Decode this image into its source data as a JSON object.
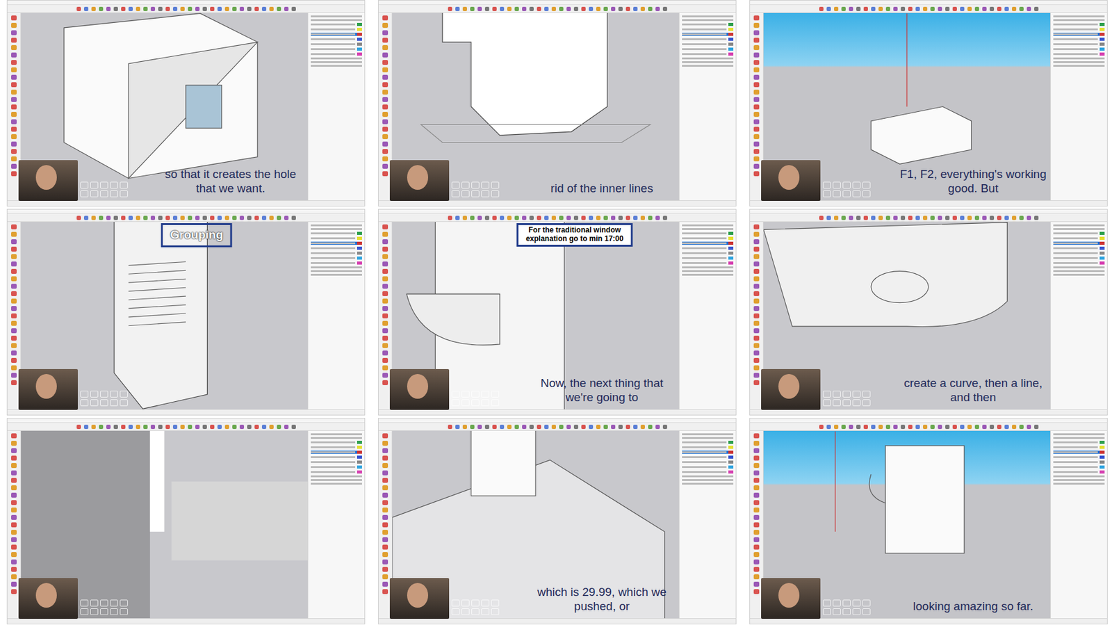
{
  "frames": [
    {
      "caption": [
        "so that it creates the hole",
        "that we want."
      ],
      "kind": "plain"
    },
    {
      "caption": [
        "rid of the inner lines"
      ],
      "kind": "plain"
    },
    {
      "caption": [
        "F1, F2, everything's working",
        "good. But"
      ],
      "kind": "sky"
    },
    {
      "caption": [],
      "kind": "plain",
      "overlay": {
        "lines": [
          "Grouping"
        ],
        "kind": "outline"
      }
    },
    {
      "caption": [
        "Now, the next thing that",
        "we're going to"
      ],
      "kind": "plain",
      "overlay": {
        "lines": [
          "For the traditional window",
          "explanation go to min 17:00"
        ],
        "kind": "boxed"
      }
    },
    {
      "caption": [
        "create a curve, then a line,",
        "and then"
      ],
      "kind": "plain"
    },
    {
      "caption": [],
      "kind": "plain"
    },
    {
      "caption": [
        "which is 29.99, which we",
        "pushed, or"
      ],
      "kind": "plain"
    },
    {
      "caption": [
        "looking amazing so far."
      ],
      "kind": "sky"
    }
  ]
}
